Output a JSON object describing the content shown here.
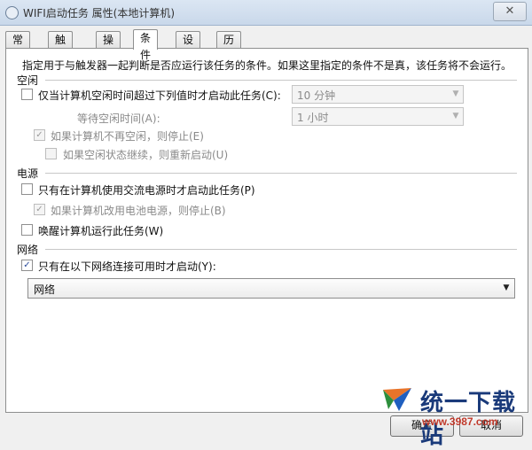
{
  "window": {
    "title": "WIFI启动任务 属性(本地计算机)",
    "close_glyph": "✕"
  },
  "tabs": [
    {
      "label": "常规",
      "active": false
    },
    {
      "label": "触发器",
      "active": false
    },
    {
      "label": "操作",
      "active": false
    },
    {
      "label": "条件",
      "active": true
    },
    {
      "label": "设置",
      "active": false
    },
    {
      "label": "历史记录",
      "active": false
    }
  ],
  "description": "指定用于与触发器一起判断是否应运行该任务的条件。如果这里指定的条件不是真，该任务将不会运行。",
  "idle": {
    "section": "空闲",
    "start_if_idle": {
      "label": "仅当计算机空闲时间超过下列值时才启动此任务(C):",
      "checked": false
    },
    "idle_for_value": "10 分钟",
    "wait_label": "等待空闲时间(A):",
    "wait_value": "1 小时",
    "stop_if_not_idle": {
      "label": "如果计算机不再空闲，则停止(E)",
      "checked": true,
      "enabled": false
    },
    "restart_if_idle_resumes": {
      "label": "如果空闲状态继续，则重新启动(U)",
      "checked": false,
      "enabled": false
    }
  },
  "power": {
    "section": "电源",
    "ac_only": {
      "label": "只有在计算机使用交流电源时才启动此任务(P)",
      "checked": false
    },
    "stop_on_battery": {
      "label": "如果计算机改用电池电源，则停止(B)",
      "checked": true,
      "enabled": false
    },
    "wake_to_run": {
      "label": "唤醒计算机运行此任务(W)",
      "checked": false
    }
  },
  "network": {
    "section": "网络",
    "only_if_network": {
      "label": "只有在以下网络连接可用时才启动(Y):",
      "checked": true
    },
    "connection_value": "网络"
  },
  "buttons": {
    "ok": "确定",
    "cancel": "取消"
  },
  "watermark": {
    "name": "统一下载站",
    "url": "www.3987.com"
  },
  "glyphs": {
    "check": "✓",
    "dropdown": "▼"
  }
}
